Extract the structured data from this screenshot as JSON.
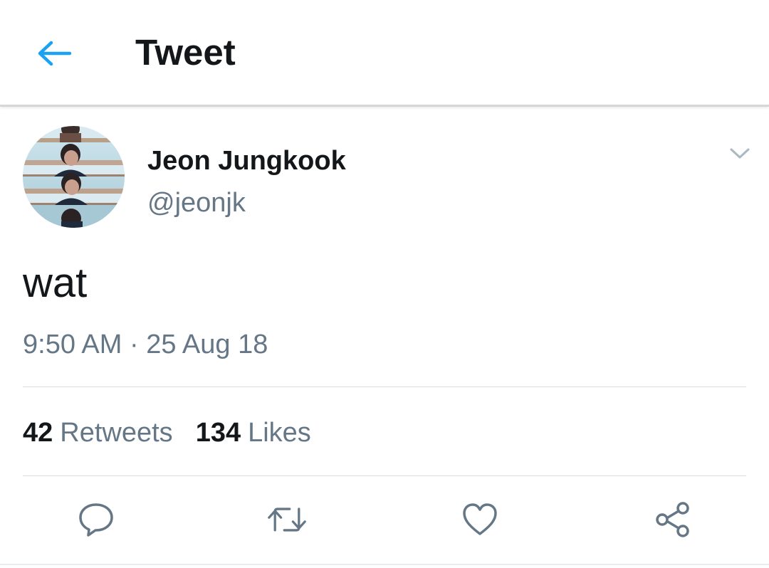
{
  "header": {
    "title": "Tweet",
    "back_icon": "arrow-left-icon",
    "accent_color": "#1da1f2"
  },
  "tweet": {
    "author": {
      "display_name": "Jeon Jungkook",
      "handle": "@jeonjk"
    },
    "text": "wat",
    "time": "9:50 AM",
    "separator": "·",
    "date": "25 Aug 18",
    "stats": {
      "retweets_count": "42",
      "retweets_label": "Retweets",
      "likes_count": "134",
      "likes_label": "Likes"
    },
    "actions": [
      "reply-icon",
      "retweet-icon",
      "like-icon",
      "share-icon"
    ]
  },
  "colors": {
    "text_primary": "#14171a",
    "text_secondary": "#657786",
    "divider": "#d6dde3",
    "icon": "#657786"
  }
}
